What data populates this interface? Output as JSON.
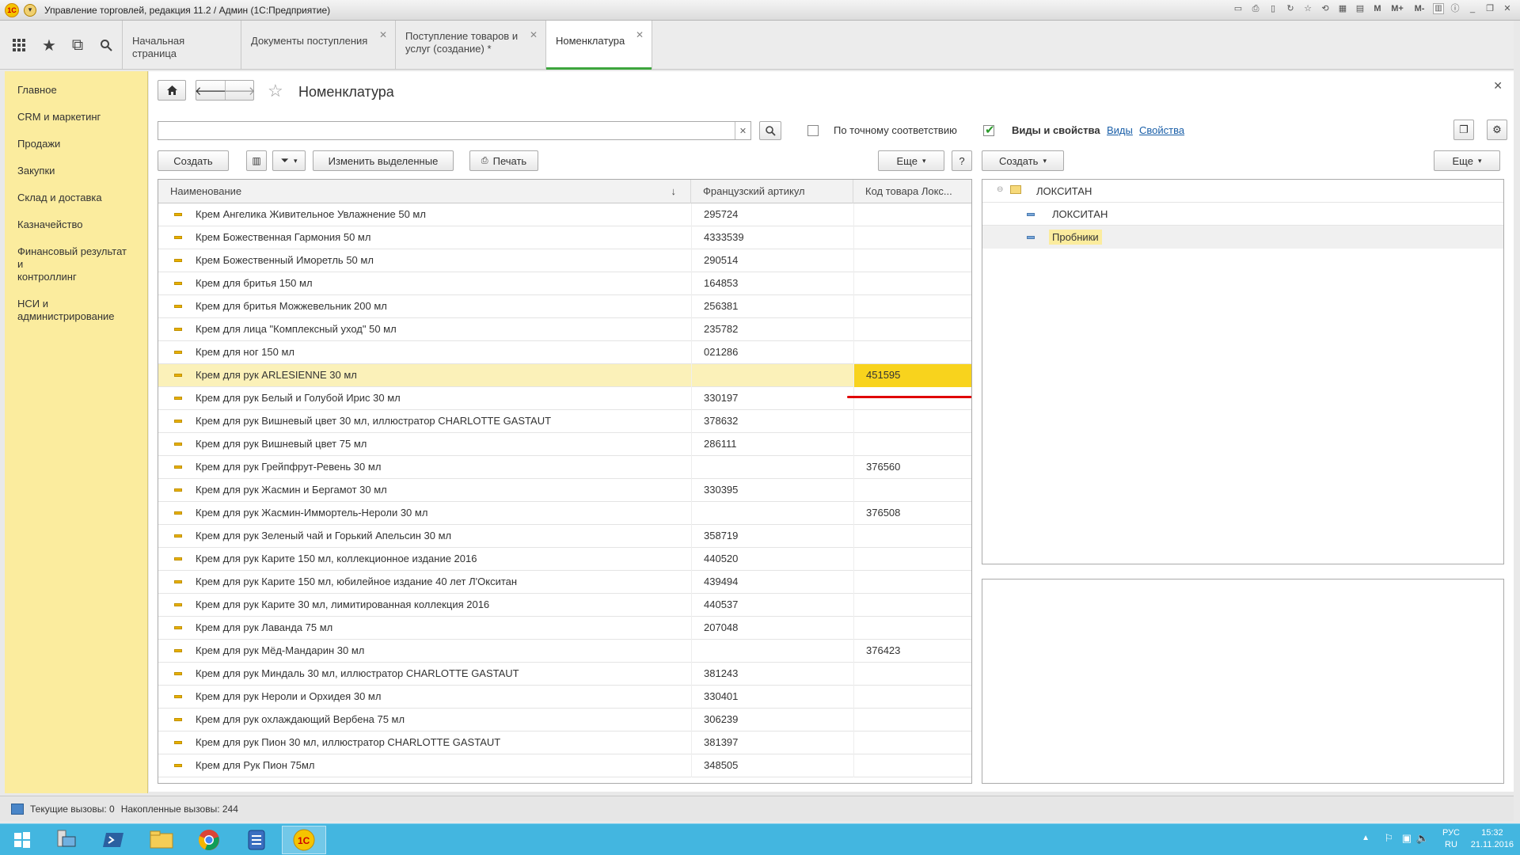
{
  "window": {
    "title": "Управление торговлей, редакция 11.2 / Админ  (1С:Предприятие)"
  },
  "tabs": [
    {
      "label": "Начальная страница"
    },
    {
      "label": "Документы поступления"
    },
    {
      "label_line1": "Поступление товаров и",
      "label_line2": "услуг (создание) *"
    },
    {
      "label": "Номенклатура"
    }
  ],
  "sidebar": {
    "items": [
      {
        "label": "Главное"
      },
      {
        "label": "CRM и маркетинг"
      },
      {
        "label": "Продажи"
      },
      {
        "label": "Закупки"
      },
      {
        "label": "Склад и доставка"
      },
      {
        "label": "Казначейство"
      },
      {
        "label_line1": "Финансовый результат и",
        "label_line2": "контроллинг"
      },
      {
        "label_line1": "НСИ и",
        "label_line2": "администрирование"
      }
    ]
  },
  "form": {
    "title": "Номенклатура",
    "search": {
      "value": ""
    },
    "exact_match_label": "По точному соответствию",
    "kinds_props_label": "Виды и свойства",
    "kinds_link": "Виды",
    "props_link": "Свойства",
    "toolbar": {
      "create": "Создать",
      "change_selected": "Изменить выделенные",
      "print": "Печать",
      "more": "Еще",
      "help": "?"
    },
    "right_toolbar": {
      "create": "Создать",
      "more": "Еще"
    }
  },
  "table": {
    "columns": [
      "Наименование",
      "Французский артикул",
      "Код товара Локс..."
    ],
    "sort_indicator": "↓",
    "selected_index": 7,
    "rows": [
      {
        "name": "Крем Ангелика Живительное Увлажнение 50 мл",
        "article": "295724",
        "code": ""
      },
      {
        "name": "Крем Божественная Гармония 50 мл",
        "article": "4333539",
        "code": ""
      },
      {
        "name": "Крем Божественный Иморетль 50 мл",
        "article": "290514",
        "code": ""
      },
      {
        "name": "Крем для бритья 150 мл",
        "article": "164853",
        "code": ""
      },
      {
        "name": "Крем для бритья Можжевельник 200 мл",
        "article": "256381",
        "code": ""
      },
      {
        "name": "Крем для лица \"Комплексный уход\" 50 мл",
        "article": "235782",
        "code": ""
      },
      {
        "name": "Крем для ног 150 мл",
        "article": "021286",
        "code": ""
      },
      {
        "name": "Крем для рук ARLESIENNE 30 мл",
        "article": "",
        "code": "451595"
      },
      {
        "name": "Крем для рук Белый и Голубой Ирис 30 мл",
        "article": "330197",
        "code": ""
      },
      {
        "name": "Крем для рук Вишневый цвет 30  мл, иллюстратор CHARLOTTE GASTAUT",
        "article": "378632",
        "code": ""
      },
      {
        "name": "Крем для рук Вишневый цвет 75 мл",
        "article": "286111",
        "code": ""
      },
      {
        "name": "Крем для рук Грейпфрут-Ревень 30 мл",
        "article": "",
        "code": "376560"
      },
      {
        "name": "Крем для рук Жасмин и Бергамот 30 мл",
        "article": "330395",
        "code": ""
      },
      {
        "name": "Крем для рук Жасмин-Иммортель-Нероли 30 мл",
        "article": "",
        "code": "376508"
      },
      {
        "name": "Крем для рук Зеленый чай и Горький Апельсин 30 мл",
        "article": "358719",
        "code": ""
      },
      {
        "name": "Крем для рук Карите 150 мл, коллекционное издание 2016",
        "article": "440520",
        "code": ""
      },
      {
        "name": "Крем для рук Карите 150 мл, юбилейное издание 40 лет Л'Окситан",
        "article": "439494",
        "code": ""
      },
      {
        "name": "Крем для рук Карите 30 мл, лимитированная коллекция 2016",
        "article": "440537",
        "code": ""
      },
      {
        "name": "Крем для рук Лаванда 75 мл",
        "article": "207048",
        "code": ""
      },
      {
        "name": "Крем для рук Мёд-Мандарин 30 мл",
        "article": "",
        "code": "376423"
      },
      {
        "name": "Крем для рук Миндаль 30 мл, иллюстратор CHARLOTTE GASTAUT",
        "article": "381243",
        "code": ""
      },
      {
        "name": "Крем для рук Нероли и Орхидея 30 мл",
        "article": "330401",
        "code": ""
      },
      {
        "name": "Крем для рук охлаждающий Вербена 75 мл",
        "article": "306239",
        "code": ""
      },
      {
        "name": "Крем для рук Пион 30 мл, иллюстратор CHARLOTTE GASTAUT",
        "article": "381397",
        "code": ""
      },
      {
        "name": "Крем для Рук Пион 75мл",
        "article": "348505",
        "code": ""
      }
    ]
  },
  "tree": {
    "root": "ЛОКСИТАН",
    "children": [
      "ЛОКСИТАН",
      "Пробники"
    ]
  },
  "statusbar": {
    "current_calls": "Текущие вызовы: 0",
    "accum_calls": "Накопленные вызовы: 244"
  },
  "taskbar": {
    "lang": "РУС",
    "locale": "RU",
    "time": "15:32",
    "date": "21.11.2016"
  },
  "colors": {
    "sidebar_bg": "#fbec9e",
    "selected_row": "#fbf1b9",
    "selected_cell": "#f8d31d",
    "active_tab_underline": "#3da53d",
    "red_underline": "#e00000",
    "taskbar": "#43b6e0"
  }
}
